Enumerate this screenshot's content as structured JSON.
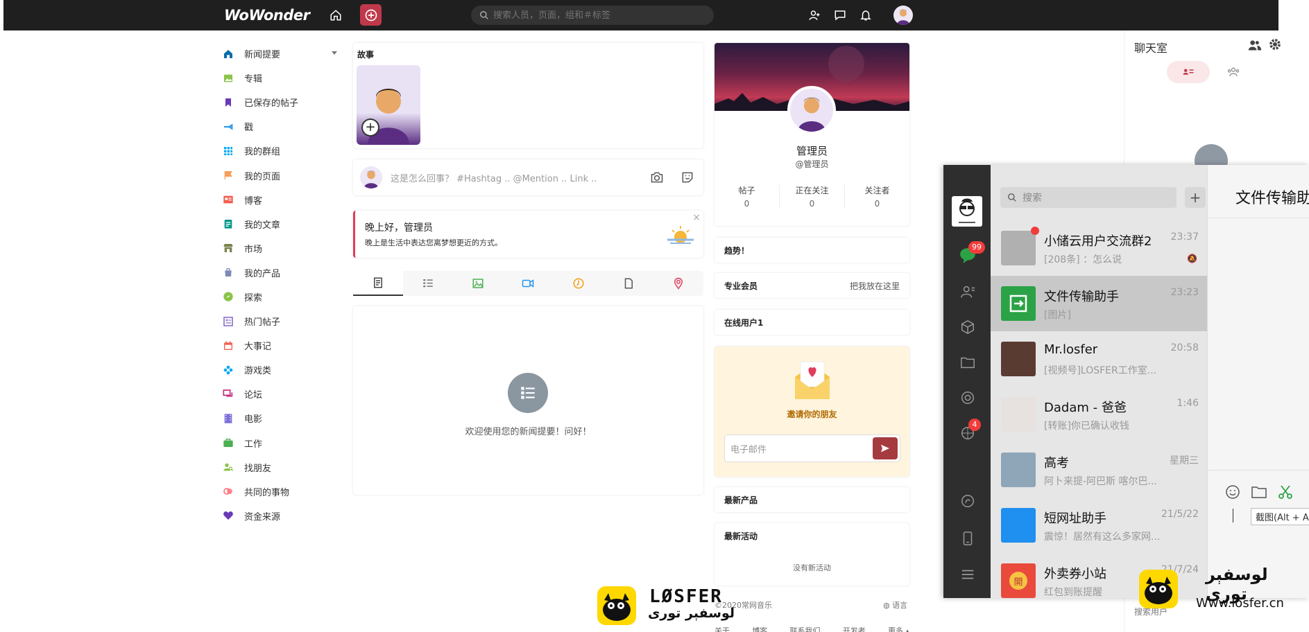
{
  "topbar": {
    "logo": "WoWonder",
    "search_placeholder": "搜索人员，页面，组和＃标签"
  },
  "sidebar": {
    "items": [
      {
        "label": "新闻提要",
        "icon": "home-icon",
        "color": "#0a6ca8"
      },
      {
        "label": "专辑",
        "icon": "album-icon",
        "color": "#8bc34a"
      },
      {
        "label": "已保存的帖子",
        "icon": "bookmark-icon",
        "color": "#673ab7"
      },
      {
        "label": "戳",
        "icon": "poke-icon",
        "color": "#2196f3"
      },
      {
        "label": "我的群组",
        "icon": "groups-icon",
        "color": "#03a9f4"
      },
      {
        "label": "我的页面",
        "icon": "flag-icon",
        "color": "#f79f58"
      },
      {
        "label": "博客",
        "icon": "blog-icon",
        "color": "#f35d4f"
      },
      {
        "label": "我的文章",
        "icon": "article-icon",
        "color": "#009688"
      },
      {
        "label": "市场",
        "icon": "market-icon",
        "color": "#7d8250"
      },
      {
        "label": "我的产品",
        "icon": "products-icon",
        "color": "#7c8bb5"
      },
      {
        "label": "探索",
        "icon": "explore-icon",
        "color": "#8bc34a"
      },
      {
        "label": "热门帖子",
        "icon": "popular-posts-icon",
        "color": "#8d73cc"
      },
      {
        "label": "大事记",
        "icon": "events-icon",
        "color": "#f25e4e"
      },
      {
        "label": "游戏类",
        "icon": "games-icon",
        "color": "#03a9f4"
      },
      {
        "label": "论坛",
        "icon": "forum-icon",
        "color": "#c3287c"
      },
      {
        "label": "电影",
        "icon": "movies-icon",
        "color": "#7c6fd8"
      },
      {
        "label": "工作",
        "icon": "jobs-icon",
        "color": "#4caf50"
      },
      {
        "label": "找朋友",
        "icon": "find-friends-icon",
        "color": "#8bc34a"
      },
      {
        "label": "共同的事物",
        "icon": "common-things-icon",
        "color": "#ff6e7c"
      },
      {
        "label": "资金来源",
        "icon": "funding-icon",
        "color": "#673ab7"
      }
    ]
  },
  "stories": {
    "title": "故事",
    "add_label": "+"
  },
  "composer": {
    "placeholder": "这是怎么回事？ #Hashtag .. @Mention .. Link .."
  },
  "greeting": {
    "title": "晚上好，管理员",
    "subtitle": "晚上是生活中表达您离梦想更近的方式。",
    "close": "×"
  },
  "post_tabs": [
    {
      "icon": "text-post-icon"
    },
    {
      "icon": "list-post-icon"
    },
    {
      "icon": "image-post-icon"
    },
    {
      "icon": "video-post-icon"
    },
    {
      "icon": "feeling-post-icon"
    },
    {
      "icon": "file-post-icon"
    },
    {
      "icon": "location-post-icon"
    }
  ],
  "feed": {
    "empty_text": "欢迎使用您的新闻提要！问好！"
  },
  "profile": {
    "name": "管理员",
    "handle": "@管理员",
    "stats": [
      {
        "label": "帖子",
        "value": "0"
      },
      {
        "label": "正在关注",
        "value": "0"
      },
      {
        "label": "关注者",
        "value": "0"
      }
    ]
  },
  "right_boxes": {
    "trending": "趋势！",
    "pro_title": "专业会员",
    "pro_action": "把我放在这里",
    "online": "在线用户1",
    "invite_title": "邀请你的朋友",
    "invite_placeholder": "电子邮件",
    "latest_products": "最新产品",
    "latest_activities": "最新活动",
    "no_activities": "没有新活动"
  },
  "footer": {
    "copyright": "©2020常网音乐",
    "language": "语言",
    "links": [
      "关于",
      "博客",
      "联系我们",
      "开发者",
      "更多 ▴"
    ]
  },
  "chat_panel": {
    "title": "聊天室",
    "search_placeholder": "搜索用户"
  },
  "wechat": {
    "search_placeholder": "搜索",
    "unread_badge": "99",
    "moments_badge": "4",
    "chats": [
      {
        "name": "小储云用户交流群2",
        "time": "23:37",
        "msg": "[208条]   ：怎么说",
        "avatar_color": "#b0b0b0",
        "dot": true
      },
      {
        "name": "文件传输助手",
        "time": "23:23",
        "msg": "[图片]",
        "avatar_color": "#2ba245",
        "active": true
      },
      {
        "name": "Mr.losfer",
        "time": "20:58",
        "msg": "[视频号]LOSFER工作室...",
        "avatar_color": "#5a3b32"
      },
      {
        "name": "Dadam - 爸爸",
        "time": "1:46",
        "msg": "[转账]你已确认收钱",
        "avatar_color": "#e7e2df"
      },
      {
        "name": "高考",
        "time": "星期三",
        "msg": "阿卜来提-阿巴斯 喀尔巴...",
        "avatar_color": "#8fa5b8"
      },
      {
        "name": "短网址助手",
        "time": "21/5/22",
        "msg": "震惊！居然有这么多家网...",
        "avatar_color": "#1f8ff0"
      },
      {
        "name": "外卖券小站",
        "time": "21/7/24",
        "msg": "红包到账提醒",
        "avatar_color": "#e94a3c",
        "avatar_text": "開"
      }
    ],
    "main_title": "文件传输助手",
    "tooltip": "截图(Alt + A)"
  },
  "watermark": {
    "brand": "LØSFER",
    "arabic": "لوسفېر تورى",
    "url": "Www.losfer.cn"
  }
}
